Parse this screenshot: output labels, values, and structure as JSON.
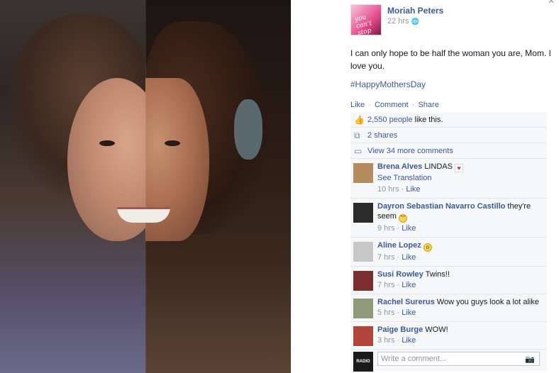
{
  "close_glyph": "✕",
  "post": {
    "page_name": "Moriah Peters",
    "avatar_text": "you can't stop me",
    "time": "22 hrs",
    "globe": "🌐",
    "text": "I can only hope to be half the woman you are, Mom. I love you.",
    "hashtag": "#HappyMothersDay",
    "actions": {
      "like": "Like",
      "comment": "Comment",
      "share": "Share",
      "sep": "·"
    }
  },
  "ufi": {
    "likes_count": "2,550 people",
    "likes_suffix": " like this.",
    "shares": "2 shares",
    "more_comments": "View 34 more comments",
    "icons": {
      "like": "like-icon",
      "share": "share-icon",
      "comment": "comment-icon"
    }
  },
  "comments": [
    {
      "name": "Brena Alves",
      "text": "LINDAS",
      "see_translation": "See Translation",
      "time": "10 hrs",
      "like": "Like",
      "avatar_color": "#b58a5c"
    },
    {
      "name": "Dayron Sebastian Navarro Castillo",
      "text": "they're seem",
      "time": "9 hrs",
      "like": "Like",
      "avatar_color": "#2b2b2b"
    },
    {
      "name": "Aline Lopez",
      "text": "",
      "time": "7 hrs",
      "like": "Like",
      "avatar_color": "#c7c7c7"
    },
    {
      "name": "Susi Rowley",
      "text": "Twins!!",
      "time": "7 hrs",
      "like": "Like",
      "avatar_color": "#7a2e2e"
    },
    {
      "name": "Rachel Surerus",
      "text": "Wow you guys look a lot alike",
      "time": "5 hrs",
      "like": "Like",
      "avatar_color": "#8f9a7a"
    },
    {
      "name": "Paige Burge",
      "text": "WOW!",
      "time": "3 hrs",
      "like": "Like",
      "avatar_color": "#b2463a"
    }
  ],
  "composer": {
    "placeholder": "Write a comment...",
    "avatar_text": "RADIO",
    "camera": "📷"
  }
}
